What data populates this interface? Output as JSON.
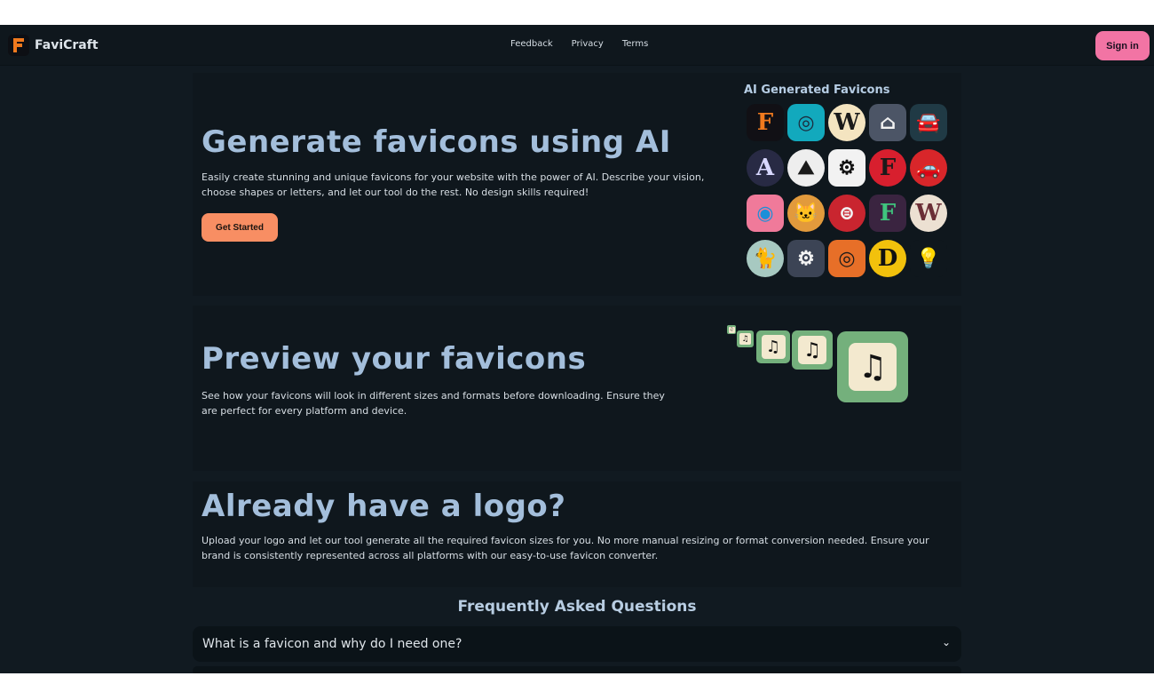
{
  "header": {
    "brand": "FaviCraft",
    "nav": [
      "Feedback",
      "Privacy",
      "Terms"
    ],
    "signin_label": "Sign in"
  },
  "hero": {
    "title": "Generate favicons using AI",
    "description": "Easily create stunning and unique favicons for your website with the power of AI. Describe your vision, choose shapes or letters, and let our tool do the rest. No design skills required!",
    "cta_label": "Get Started",
    "gallery_title": "AI Generated Favicons",
    "gallery": [
      {
        "icon": "letter-f-icon",
        "bg": "#111015",
        "fg": "#f07a1e",
        "glyph": "F",
        "shape": "square"
      },
      {
        "icon": "lifebuoy-icon",
        "bg": "#12a9bd",
        "fg": "#1d2a3c",
        "glyph": "◎",
        "shape": "square"
      },
      {
        "icon": "letter-w-icon",
        "bg": "#f4e4c0",
        "fg": "#1a1a1a",
        "glyph": "W",
        "shape": "round"
      },
      {
        "icon": "house-icon",
        "bg": "#4c5566",
        "fg": "#f2f2f2",
        "glyph": "⌂",
        "shape": "square"
      },
      {
        "icon": "car-front-icon",
        "bg": "#203a45",
        "fg": "#f1f1f1",
        "glyph": "🚘",
        "shape": "square"
      },
      {
        "icon": "letter-a-icon",
        "bg": "#282a44",
        "fg": "#d8d8ff",
        "glyph": "A",
        "shape": "round"
      },
      {
        "icon": "mountain-car-icon",
        "bg": "#eeeeee",
        "fg": "#1a1a1a",
        "glyph": "⛰",
        "shape": "round"
      },
      {
        "icon": "robot-icon",
        "bg": "#f2f2f2",
        "fg": "#111111",
        "glyph": "⚙",
        "shape": "square"
      },
      {
        "icon": "letter-f-red-icon",
        "bg": "#d81f2e",
        "fg": "#1a1a1a",
        "glyph": "F",
        "shape": "round"
      },
      {
        "icon": "red-car-icon",
        "bg": "#d8262a",
        "fg": "#f5f5f5",
        "glyph": "🚗",
        "shape": "round"
      },
      {
        "icon": "map-pin-icon",
        "bg": "#f07a9a",
        "fg": "#1d8fd8",
        "glyph": "◉",
        "shape": "square"
      },
      {
        "icon": "cat-icon",
        "bg": "#e29a3c",
        "fg": "#3a3f48",
        "glyph": "🐱",
        "shape": "round"
      },
      {
        "icon": "red-lock-icon",
        "bg": "#c9252f",
        "fg": "#f2f2f2",
        "glyph": "⊜",
        "shape": "round"
      },
      {
        "icon": "letter-f-green-icon",
        "bg": "#3a2440",
        "fg": "#3fc47d",
        "glyph": "F",
        "shape": "square"
      },
      {
        "icon": "letter-w-brown-icon",
        "bg": "#ece0d2",
        "fg": "#6b2e36",
        "glyph": "W",
        "shape": "round"
      },
      {
        "icon": "cat-badge-icon",
        "bg": "#a7c9c1",
        "fg": "#3a4a48",
        "glyph": "🐈",
        "shape": "round"
      },
      {
        "icon": "gear-color-icon",
        "bg": "#3c4455",
        "fg": "#f3f3f3",
        "glyph": "⚙",
        "shape": "square"
      },
      {
        "icon": "orange-target-icon",
        "bg": "#e76f28",
        "fg": "#1a1a1a",
        "glyph": "◎",
        "shape": "square"
      },
      {
        "icon": "letter-d-hex-icon",
        "bg": "#f2c10c",
        "fg": "#111111",
        "glyph": "D",
        "shape": "round"
      },
      {
        "icon": "lightbulb-icon",
        "bg": "#0f171d",
        "fg": "#f0b37a",
        "glyph": "💡",
        "shape": "square"
      }
    ]
  },
  "preview": {
    "title": "Preview your favicons",
    "description": "See how your favicons will look in different sizes and formats before downloading. Ensure they are perfect for every platform and device.",
    "icon": "music-note-icon",
    "glyph": "♫"
  },
  "upload": {
    "title": "Already have a logo?",
    "description": "Upload your logo and let our tool generate all the required favicon sizes for you. No more manual resizing or format conversion needed. Ensure your brand is consistently represented across all platforms with our easy-to-use favicon converter."
  },
  "faq": {
    "title": "Frequently Asked Questions",
    "items": [
      "What is a favicon and why do I need one?"
    ]
  }
}
